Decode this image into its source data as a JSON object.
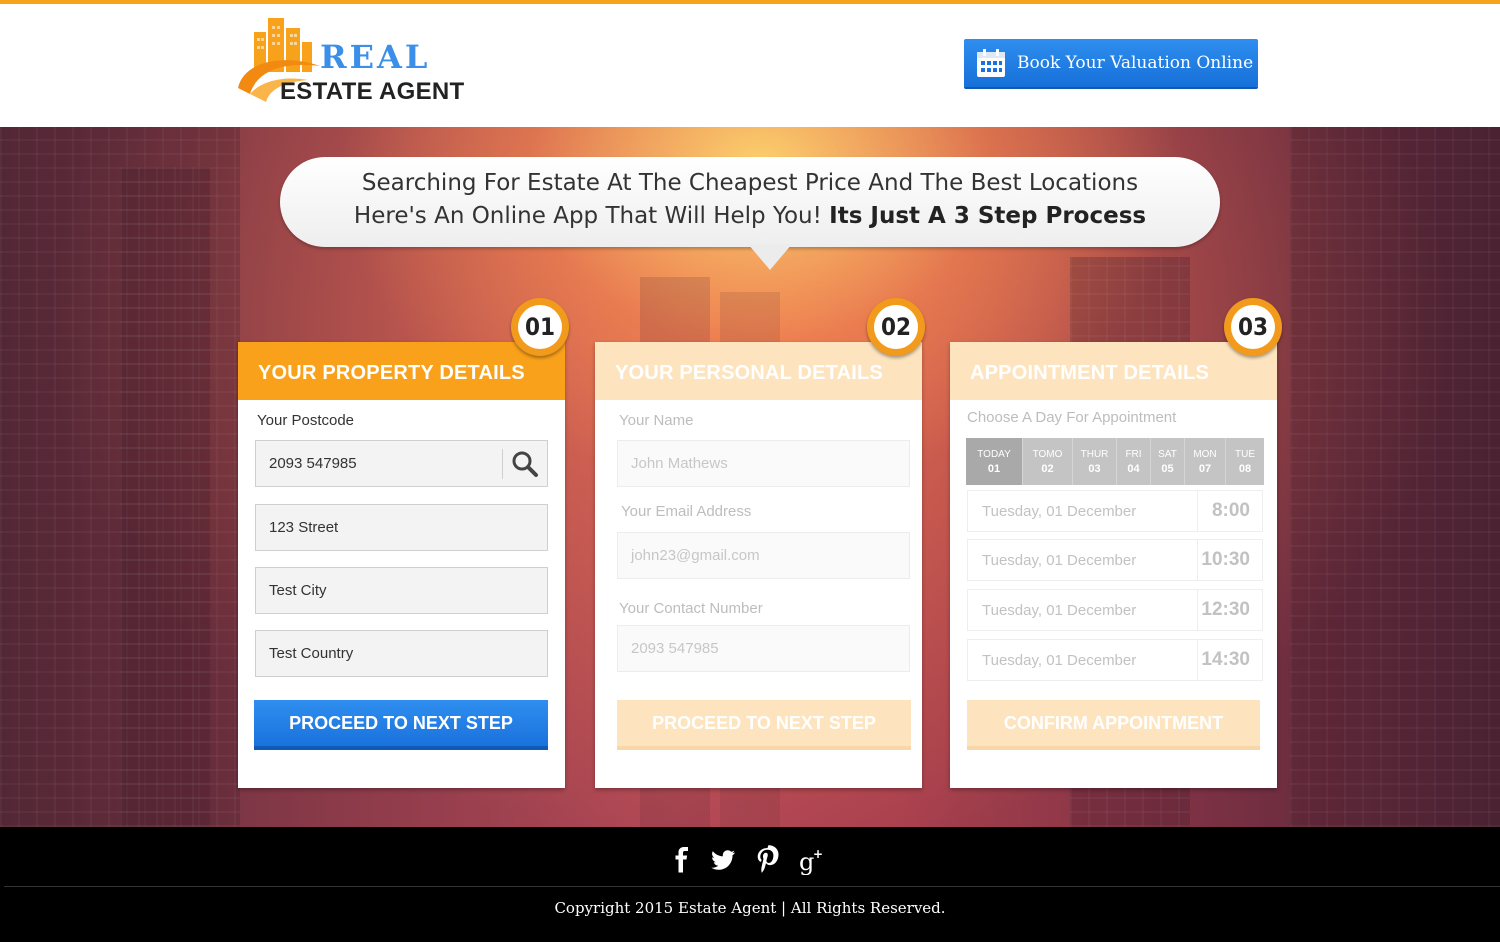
{
  "brand": {
    "logo_top": "REAL",
    "logo_bottom": "ESTATE AGENT"
  },
  "header": {
    "book_button_label": "Book Your Valuation Online"
  },
  "hero": {
    "line1": "Searching For Estate At The Cheapest Price And The Best Locations",
    "line2_regular": "Here's An Online App That Will Help You! ",
    "line2_bold": "Its Just A 3 Step Process"
  },
  "step1": {
    "number": "01",
    "title": "YOUR PROPERTY DETAILS",
    "postcode_label": "Your Postcode",
    "postcode_value": "2093 547985",
    "street_value": "123 Street",
    "city_value": "Test City",
    "country_value": "Test Country",
    "button_label": "PROCEED TO NEXT STEP"
  },
  "step2": {
    "number": "02",
    "title": "YOUR PERSONAL DETAILS",
    "name_label": "Your Name",
    "name_value": "John Mathews",
    "email_label": "Your Email Address",
    "email_value": "john23@gmail.com",
    "phone_label": "Your Contact Number",
    "phone_value": "2093 547985",
    "button_label": "PROCEED TO NEXT STEP"
  },
  "step3": {
    "number": "03",
    "title": "APPOINTMENT DETAILS",
    "choose_label": "Choose A Day For Appointment",
    "days": [
      {
        "name": "TODAY",
        "num": "01"
      },
      {
        "name": "TOMO",
        "num": "02"
      },
      {
        "name": "THUR",
        "num": "03"
      },
      {
        "name": "FRI",
        "num": "04"
      },
      {
        "name": "SAT",
        "num": "05"
      },
      {
        "name": "MON",
        "num": "07"
      },
      {
        "name": "TUE",
        "num": "08"
      }
    ],
    "slots": [
      {
        "date": "Tuesday, 01 December",
        "time": "8:00"
      },
      {
        "date": "Tuesday, 01 December",
        "time": "10:30"
      },
      {
        "date": "Tuesday, 01 December",
        "time": "12:30"
      },
      {
        "date": "Tuesday, 01 December",
        "time": "14:30"
      }
    ],
    "button_label": "CONFIRM APPOINTMENT"
  },
  "footer": {
    "social": [
      "facebook-icon",
      "twitter-icon",
      "pinterest-icon",
      "google-plus-icon"
    ],
    "copyright": "Copyright 2015 Estate Agent  |  All Rights Reserved."
  },
  "colors": {
    "accent_orange": "#f9a11b",
    "accent_blue": "#1a72dd",
    "top_bar": "#f7a21b"
  }
}
